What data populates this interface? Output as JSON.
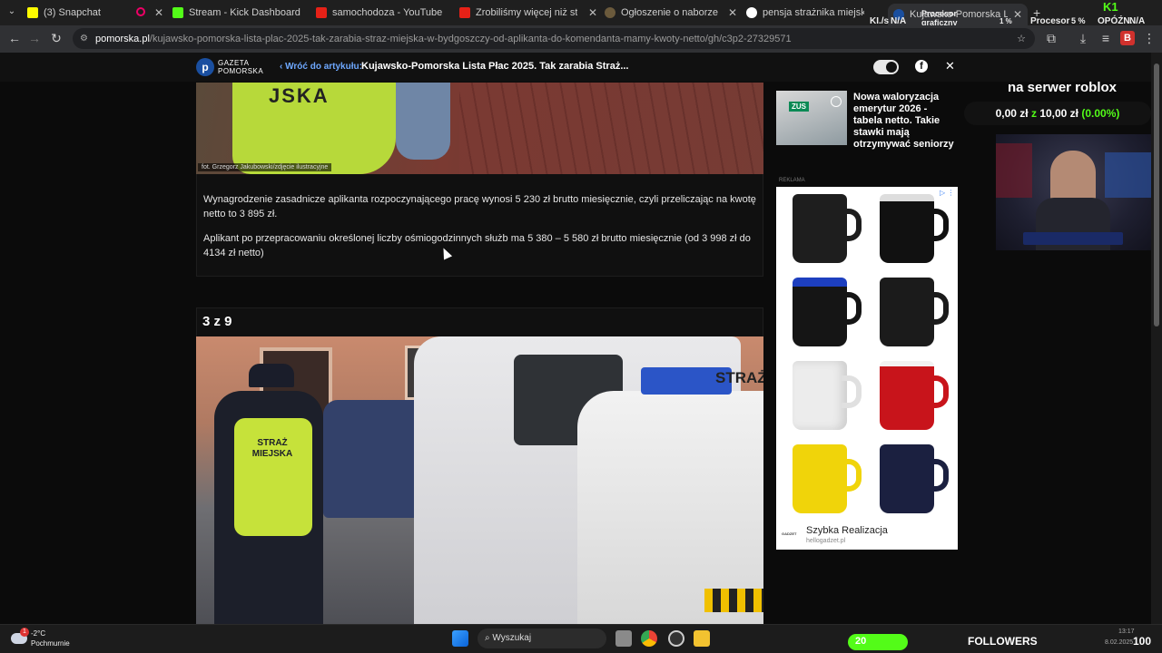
{
  "browser": {
    "tabs": [
      {
        "label": "(3) Snapchat",
        "favicon": "snapchat-icon"
      },
      {
        "label": "Stream - Kick Dashboard",
        "favicon": "kick-icon"
      },
      {
        "label": "samochodoza - YouTube",
        "favicon": "youtube-icon"
      },
      {
        "label": "Zrobiliśmy więcej niż straż miej",
        "favicon": "youtube-icon"
      },
      {
        "label": "Ogłoszenie o naborze na stanc",
        "favicon": "shield-icon"
      },
      {
        "label": "pensja strażnika miejskiego - G",
        "favicon": "google-icon"
      },
      {
        "label": "Kujawsko-Pomorska Lista Płac",
        "favicon": "gp-icon"
      }
    ],
    "new_tab": "+",
    "url_host": "pomorska.pl",
    "url_path": "/kujawsko-pomorska-lista-plac-2025-tak-zarabia-straz-miejska-w-bydgoszczy-od-aplikanta-do-komendanta-mamy-kwoty-netto/gh/c3p2-27329571",
    "profile_letter": "B"
  },
  "perf_overlay": {
    "kls_label": "KI./s",
    "kls_value": "N/A",
    "gpu_label": "Procesor graficzny",
    "gpu_value": "1 %",
    "cpu_label": "Procesor",
    "cpu_value": "5 %",
    "lag_label": "OPÓŹN.",
    "lag_value": "N/A",
    "brand_letter": "K1"
  },
  "site": {
    "logo_line1": "GAZETA",
    "logo_line2": "POMORSKA",
    "logo_letter": "p",
    "back_link": "Wróć do artykułu:",
    "article_title": "Kujawsko-Pomorska Lista Płac 2025. Tak zarabia Straż...",
    "facebook": "f",
    "close": "✕"
  },
  "article": {
    "photo_credit": "fot. Grzegorz Jakubowski/zdjęcie ilustracyjne",
    "photo1_text": "JSKA",
    "paragraph1": "Wynagrodzenie zasadnicze aplikanta rozpoczynającego pracę wynosi 5 230 zł brutto miesięcznie, czyli przeliczając na kwotę netto to 3 895 zł.",
    "paragraph2": "Aplikant po przepracowaniu określonej liczby ośmiogodzinnych służb ma 5 380 –  5 580 zł brutto miesięcznie (od  3 998  zł do 4134 zł netto)",
    "gallery_counter": "3 z 9",
    "photo2_vest_text": "STRAŻ MIEJSKA",
    "photo2_van_text": "STRAŻ"
  },
  "sidebar": {
    "related_title": "Nowa waloryzacja emerytur 2026 - tabela netto. Takie stawki mają otrzymywać seniorzy",
    "related_thumb_text": "ZUS",
    "ad_label": "REKLAMA",
    "ad_brand": "Szybka Realizacja",
    "ad_domain": "hellogadzet.pl",
    "ad_brand_logo": "GADZET"
  },
  "stream_overlay": {
    "goal_title": "na serwer roblox",
    "goal_current": "0,00 zł",
    "goal_sep": "z",
    "goal_target": "10,00 zł",
    "goal_pct": "(0.00%)",
    "colors": {
      "green": "#53fc18"
    }
  },
  "taskbar": {
    "weather_temp": "-2°C",
    "weather_desc": "Pochmurnie",
    "weather_badge": "1",
    "search_placeholder": "Wyszukaj",
    "followers_count": "20",
    "followers_label": "FOLLOWERS",
    "followers_goal": "100",
    "time": "13:17",
    "date": "8.02.2025"
  }
}
